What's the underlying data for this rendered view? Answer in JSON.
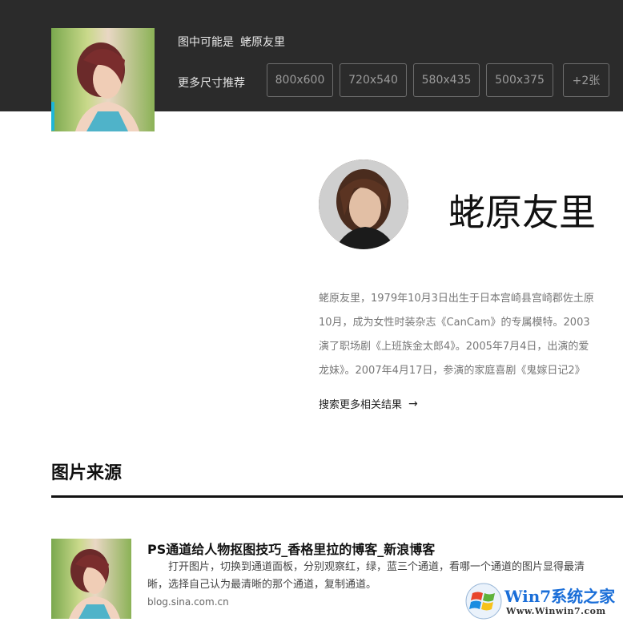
{
  "header": {
    "guess_prefix": "图中可能是",
    "guess_name": "蛯原友里",
    "sizes_label": "更多尺寸推荐",
    "sizes": [
      "800x600",
      "720x540",
      "580x435",
      "500x375",
      "+2张"
    ]
  },
  "person": {
    "name": "蛯原友里",
    "bio_lines": [
      "蛯原友里，1979年10月3日出生于日本宫崎县宫崎郡佐土原",
      "10月，成为女性时装杂志《CanCam》的专属模特。2003",
      "演了职场剧《上班族金太郎4》。2005年7月4日，出演的爱",
      "龙妹》。2007年4月17日，参演的家庭喜剧《鬼嫁日记2》"
    ],
    "more_link": "搜索更多相关结果",
    "more_arrow": "→"
  },
  "sources": {
    "heading": "图片来源",
    "items": [
      {
        "title": "PS通道给人物抠图技巧_香格里拉的博客_新浪博客",
        "description": "　　打开图片，切换到通道面板，分别观察红，绿，蓝三个通道，看哪一个通道的图片显得最清晰，选择自己认为最清晰的那个通道，复制通道。",
        "url": "blog.sina.com.cn"
      }
    ]
  },
  "watermark": {
    "text": "Win7系统之家",
    "url": "Www.Winwin7.com"
  },
  "colors": {
    "topbar": "#2b2b2b",
    "accent": "#1fb6d6",
    "watermark_blue": "#1a6ed8"
  }
}
